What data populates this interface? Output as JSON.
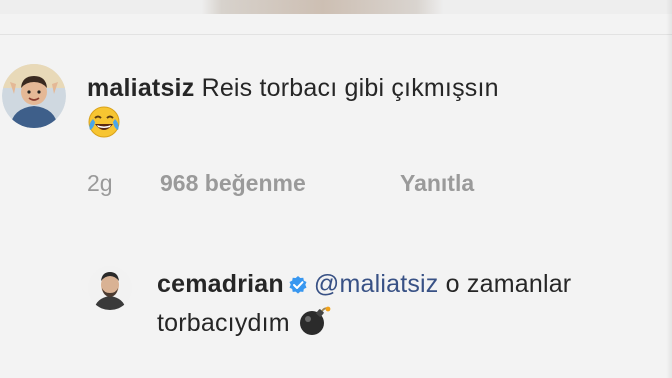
{
  "comments": [
    {
      "username": "maliatsiz",
      "text": "Reis torbacı gibi çıkmışsın",
      "emoji": "face-with-tears-of-joy-emoji",
      "time": "2g",
      "likes": "968 beğenme",
      "reply_label": "Yanıtla"
    },
    {
      "username": "cemadrian",
      "verified": true,
      "mention": "@maliatsiz",
      "text": "o zamanlar torbacıydım",
      "emoji": "bomb-emoji"
    }
  ],
  "colors": {
    "text": "#262626",
    "meta": "#9a9a9a",
    "mention": "#385185",
    "verified": "#3897f0"
  }
}
